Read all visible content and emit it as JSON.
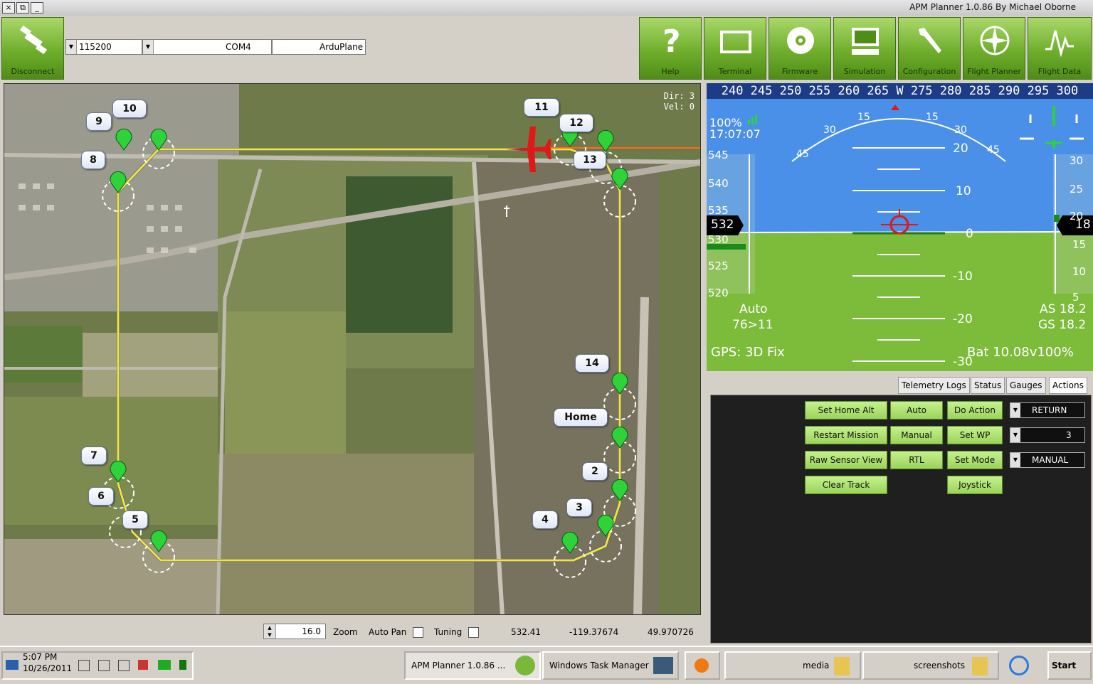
{
  "window": {
    "title": "APM Planner 1.0.86  By Michael Oborne",
    "buttons": [
      "×",
      "⧉",
      "_"
    ]
  },
  "toolbar": {
    "buttons": [
      {
        "label": "Flight Data",
        "icon": "flight-data-icon"
      },
      {
        "label": "Flight Planner",
        "icon": "compass-icon"
      },
      {
        "label": "Configuration",
        "icon": "wrench-icon"
      },
      {
        "label": "Simulation",
        "icon": "simulation-icon"
      },
      {
        "label": "Firmware",
        "icon": "disc-icon"
      },
      {
        "label": "Terminal",
        "icon": "terminal-icon"
      },
      {
        "label": "Help",
        "icon": "help-icon"
      }
    ],
    "disconnect_label": "Disconnect",
    "vehicle": "ArduPlane",
    "port": "COM4",
    "baud": "115200"
  },
  "map": {
    "dir": "Dir: 3",
    "vel": "Vel: 0",
    "waypoints": [
      "11",
      "12",
      "13",
      "10",
      "9",
      "8",
      "14",
      "Home",
      "2",
      "3",
      "4",
      "5",
      "6",
      "7"
    ]
  },
  "map_status": {
    "lat": "49.970726",
    "lng": "-119.37674",
    "alt": "532.41",
    "tuning_label": "Tuning",
    "autopan_label": "Auto Pan",
    "zoom_label": "Zoom",
    "zoom_value": "16.0"
  },
  "hud": {
    "heading_tape": "240 245 250 255 260 265 W 275 280 285 290 295 300",
    "pitch_labels": [
      "20",
      "10",
      "0",
      "-10",
      "-20",
      "-30"
    ],
    "roll_labels": [
      "15",
      "15",
      "30",
      "30",
      "45",
      "45"
    ],
    "alt_ticks": [
      "545",
      "540",
      "535",
      "530",
      "525",
      "520"
    ],
    "alt_value": "532",
    "speed_ticks": [
      "30",
      "25",
      "20",
      "15",
      "10",
      "5"
    ],
    "speed_value": "18",
    "link": "100%",
    "time": "17:07:07",
    "mode": "Auto",
    "wp": "76>11",
    "airspeed": "AS 18.2",
    "groundspeed": "GS 18.2",
    "battery": "Bat 10.08v100%",
    "gps": "GPS: 3D Fix"
  },
  "tabs": [
    "Actions",
    "Gauges",
    "Status",
    "Telemetry Logs"
  ],
  "actions": {
    "selects": [
      "RETURN",
      "3",
      "MANUAL"
    ],
    "col1": [
      "Do Action",
      "Set WP",
      "Set Mode",
      "Joystick"
    ],
    "col2": [
      "Auto",
      "Manual",
      "RTL"
    ],
    "col3": [
      "Set Home Alt",
      "Restart Mission",
      "Raw Sensor View",
      "Clear Track"
    ]
  },
  "taskbar": {
    "start": "Start",
    "tasks": [
      "screenshots",
      "media",
      "Windows Task Manager",
      "APM Planner 1.0.86 ..."
    ],
    "time": "5:07 PM",
    "date": "10/26/2011"
  },
  "colors": {
    "accent_green": "#7ab83a",
    "track_yellow": "#f2e63a",
    "route_blue": "#3a3f8a",
    "plane_red": "#e01818"
  }
}
